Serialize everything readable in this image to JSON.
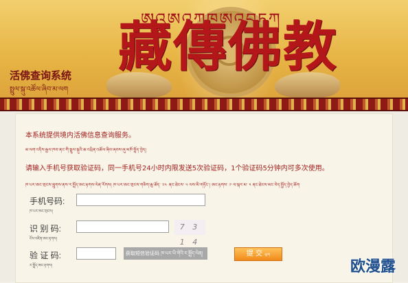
{
  "banner": {
    "tibetan_header": "ཨའཨའཀཁཨའབཏཀ",
    "title": "藏傳佛教",
    "system_title": "活佛查询系统",
    "system_title_tibetan": "སྤྲུལ་སྐུ་འཚོལ་ཞིབ་མ་ལག"
  },
  "notice": {
    "intro": "本系统提供境内活佛信息查询服务。",
    "intro_tibetan": "མ་ལག་འདིས་རྒྱལ་ཁབ་ནང་གི་སྤྲུལ་སྐུའི་ཆ་འཕྲིན་འཚོལ་ཞིབ་ཞབས་ཞུ་མཁོ་སྤྲོད་བྱེད།",
    "sms_rule": "请输入手机号获取验证码，同一手机号24小时内限发送5次验证码，1个验证码5分钟内可多次使用。",
    "sms_rule_tibetan": "ཁ་པར་ཨང་གྲངས་བླུགས་ནས་ར་སྤྲོད་ཨང་རྟགས་ལེན་རོགས། ཁ་པར་ཨང་གྲངས་གཅིག་ཆུ་ཚོད་ ༢༤ ནང་ཐེངས་ ༥ ལས་མི་གཏོང་། ཨང་རྟགས་ ༡ ལ་སྐར་མ་ ༥ ནང་ཐེངས་མང་བེད་སྤྱོད་བྱེད་ཆོག"
  },
  "form": {
    "phone_label": "手机号码:",
    "phone_tibetan": "ཁ་པར་ཨང་གྲངས།",
    "phone_value": "",
    "captcha_label": "识  别  码:",
    "captcha_tibetan": "ངོས་འཛིན་ཨང་རྟགས།",
    "captcha_value": "",
    "captcha_image_text": "7 3 1 4",
    "code_label": "验  证  码:",
    "code_tibetan": "ར་སྤྲོད་ཨང་རྟགས།",
    "code_value": "",
    "sms_button": "获取短信验证码 ཁ་པར་ཡི་གེའི་ར་སྤྲོད་ལེན།",
    "submit_label": "提 交",
    "submit_tibetan": "ཕུལ།"
  },
  "watermark": "欧漫露",
  "colors": {
    "banner_gold": "#e7b545",
    "title_red": "#b3171a",
    "text_red": "#a2201e",
    "submit_orange": "#f08a1a",
    "watermark_blue": "#1f4e8c"
  }
}
